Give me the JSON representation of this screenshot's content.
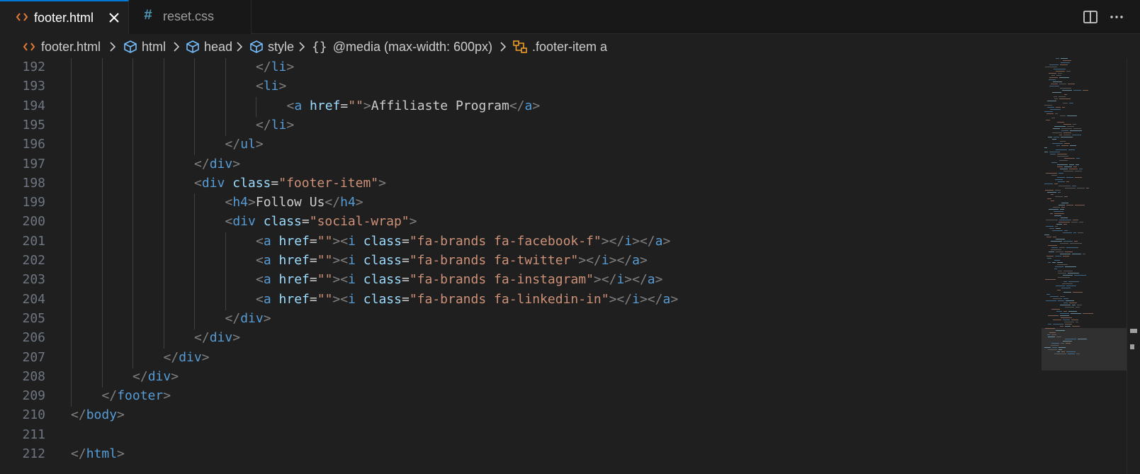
{
  "tabs": [
    {
      "label": "footer.html",
      "icon": "html-file-icon",
      "active": true
    },
    {
      "label": "reset.css",
      "icon": "css-file-icon",
      "active": false
    }
  ],
  "breadcrumb": {
    "file": "footer.html",
    "items": [
      "html",
      "head",
      "style",
      "@media (max-width: 600px)",
      ".footer-item a"
    ]
  },
  "colors": {
    "tag": "#569cd6",
    "attribute": "#9cdcfe",
    "string": "#ce9178",
    "punctuation": "#808080",
    "text": "#cccccc",
    "accent": "#0078d4"
  },
  "code": {
    "lines": [
      {
        "num": "192",
        "tokens": [
          [
            "p",
            "</"
          ],
          [
            "t",
            "li"
          ],
          [
            "p",
            ">"
          ]
        ]
      },
      {
        "num": "193",
        "tokens": [
          [
            "p",
            "<"
          ],
          [
            "t",
            "li"
          ],
          [
            "p",
            ">"
          ]
        ]
      },
      {
        "num": "194",
        "tokens": [
          [
            "p",
            "<"
          ],
          [
            "t",
            "a"
          ],
          [
            "x",
            " "
          ],
          [
            "a",
            "href"
          ],
          [
            "e",
            "="
          ],
          [
            "s",
            "\"\""
          ],
          [
            "p",
            ">"
          ],
          [
            "x",
            "Affiliaste Program"
          ],
          [
            "p",
            "</"
          ],
          [
            "t",
            "a"
          ],
          [
            "p",
            ">"
          ]
        ]
      },
      {
        "num": "195",
        "tokens": [
          [
            "p",
            "</"
          ],
          [
            "t",
            "li"
          ],
          [
            "p",
            ">"
          ]
        ]
      },
      {
        "num": "196",
        "tokens": [
          [
            "p",
            "</"
          ],
          [
            "t",
            "ul"
          ],
          [
            "p",
            ">"
          ]
        ]
      },
      {
        "num": "197",
        "tokens": [
          [
            "p",
            "</"
          ],
          [
            "t",
            "div"
          ],
          [
            "p",
            ">"
          ]
        ]
      },
      {
        "num": "198",
        "tokens": [
          [
            "p",
            "<"
          ],
          [
            "t",
            "div"
          ],
          [
            "x",
            " "
          ],
          [
            "a",
            "class"
          ],
          [
            "e",
            "="
          ],
          [
            "s",
            "\"footer-item\""
          ],
          [
            "p",
            ">"
          ]
        ]
      },
      {
        "num": "199",
        "tokens": [
          [
            "p",
            "<"
          ],
          [
            "t",
            "h4"
          ],
          [
            "p",
            ">"
          ],
          [
            "x",
            "Follow Us"
          ],
          [
            "p",
            "</"
          ],
          [
            "t",
            "h4"
          ],
          [
            "p",
            ">"
          ]
        ]
      },
      {
        "num": "200",
        "tokens": [
          [
            "p",
            "<"
          ],
          [
            "t",
            "div"
          ],
          [
            "x",
            " "
          ],
          [
            "a",
            "class"
          ],
          [
            "e",
            "="
          ],
          [
            "s",
            "\"social-wrap\""
          ],
          [
            "p",
            ">"
          ]
        ]
      },
      {
        "num": "201",
        "tokens": [
          [
            "p",
            "<"
          ],
          [
            "t",
            "a"
          ],
          [
            "x",
            " "
          ],
          [
            "a",
            "href"
          ],
          [
            "e",
            "="
          ],
          [
            "s",
            "\"\""
          ],
          [
            "p",
            "><"
          ],
          [
            "t",
            "i"
          ],
          [
            "x",
            " "
          ],
          [
            "a",
            "class"
          ],
          [
            "e",
            "="
          ],
          [
            "s",
            "\"fa-brands fa-facebook-f\""
          ],
          [
            "p",
            "></"
          ],
          [
            "t",
            "i"
          ],
          [
            "p",
            "></"
          ],
          [
            "t",
            "a"
          ],
          [
            "p",
            ">"
          ]
        ]
      },
      {
        "num": "202",
        "tokens": [
          [
            "p",
            "<"
          ],
          [
            "t",
            "a"
          ],
          [
            "x",
            " "
          ],
          [
            "a",
            "href"
          ],
          [
            "e",
            "="
          ],
          [
            "s",
            "\"\""
          ],
          [
            "p",
            "><"
          ],
          [
            "t",
            "i"
          ],
          [
            "x",
            " "
          ],
          [
            "a",
            "class"
          ],
          [
            "e",
            "="
          ],
          [
            "s",
            "\"fa-brands fa-twitter\""
          ],
          [
            "p",
            "></"
          ],
          [
            "t",
            "i"
          ],
          [
            "p",
            "></"
          ],
          [
            "t",
            "a"
          ],
          [
            "p",
            ">"
          ]
        ]
      },
      {
        "num": "203",
        "tokens": [
          [
            "p",
            "<"
          ],
          [
            "t",
            "a"
          ],
          [
            "x",
            " "
          ],
          [
            "a",
            "href"
          ],
          [
            "e",
            "="
          ],
          [
            "s",
            "\"\""
          ],
          [
            "p",
            "><"
          ],
          [
            "t",
            "i"
          ],
          [
            "x",
            " "
          ],
          [
            "a",
            "class"
          ],
          [
            "e",
            "="
          ],
          [
            "s",
            "\"fa-brands fa-instagram\""
          ],
          [
            "p",
            "></"
          ],
          [
            "t",
            "i"
          ],
          [
            "p",
            "></"
          ],
          [
            "t",
            "a"
          ],
          [
            "p",
            ">"
          ]
        ]
      },
      {
        "num": "204",
        "tokens": [
          [
            "p",
            "<"
          ],
          [
            "t",
            "a"
          ],
          [
            "x",
            " "
          ],
          [
            "a",
            "href"
          ],
          [
            "e",
            "="
          ],
          [
            "s",
            "\"\""
          ],
          [
            "p",
            "><"
          ],
          [
            "t",
            "i"
          ],
          [
            "x",
            " "
          ],
          [
            "a",
            "class"
          ],
          [
            "e",
            "="
          ],
          [
            "s",
            "\"fa-brands fa-linkedin-in\""
          ],
          [
            "p",
            "></"
          ],
          [
            "t",
            "i"
          ],
          [
            "p",
            "></"
          ],
          [
            "t",
            "a"
          ],
          [
            "p",
            ">"
          ]
        ]
      },
      {
        "num": "205",
        "tokens": [
          [
            "p",
            "</"
          ],
          [
            "t",
            "div"
          ],
          [
            "p",
            ">"
          ]
        ]
      },
      {
        "num": "206",
        "tokens": [
          [
            "p",
            "</"
          ],
          [
            "t",
            "div"
          ],
          [
            "p",
            ">"
          ]
        ]
      },
      {
        "num": "207",
        "tokens": [
          [
            "p",
            "</"
          ],
          [
            "t",
            "div"
          ],
          [
            "p",
            ">"
          ]
        ]
      },
      {
        "num": "208",
        "tokens": [
          [
            "p",
            "</"
          ],
          [
            "t",
            "div"
          ],
          [
            "p",
            ">"
          ]
        ]
      },
      {
        "num": "209",
        "tokens": [
          [
            "p",
            "</"
          ],
          [
            "t",
            "footer"
          ],
          [
            "p",
            ">"
          ]
        ]
      },
      {
        "num": "210",
        "tokens": [
          [
            "p",
            "</"
          ],
          [
            "t",
            "body"
          ],
          [
            "p",
            ">"
          ]
        ]
      },
      {
        "num": "211",
        "tokens": []
      },
      {
        "num": "212",
        "tokens": [
          [
            "p",
            "</"
          ],
          [
            "t",
            "html"
          ],
          [
            "p",
            ">"
          ]
        ]
      }
    ]
  }
}
